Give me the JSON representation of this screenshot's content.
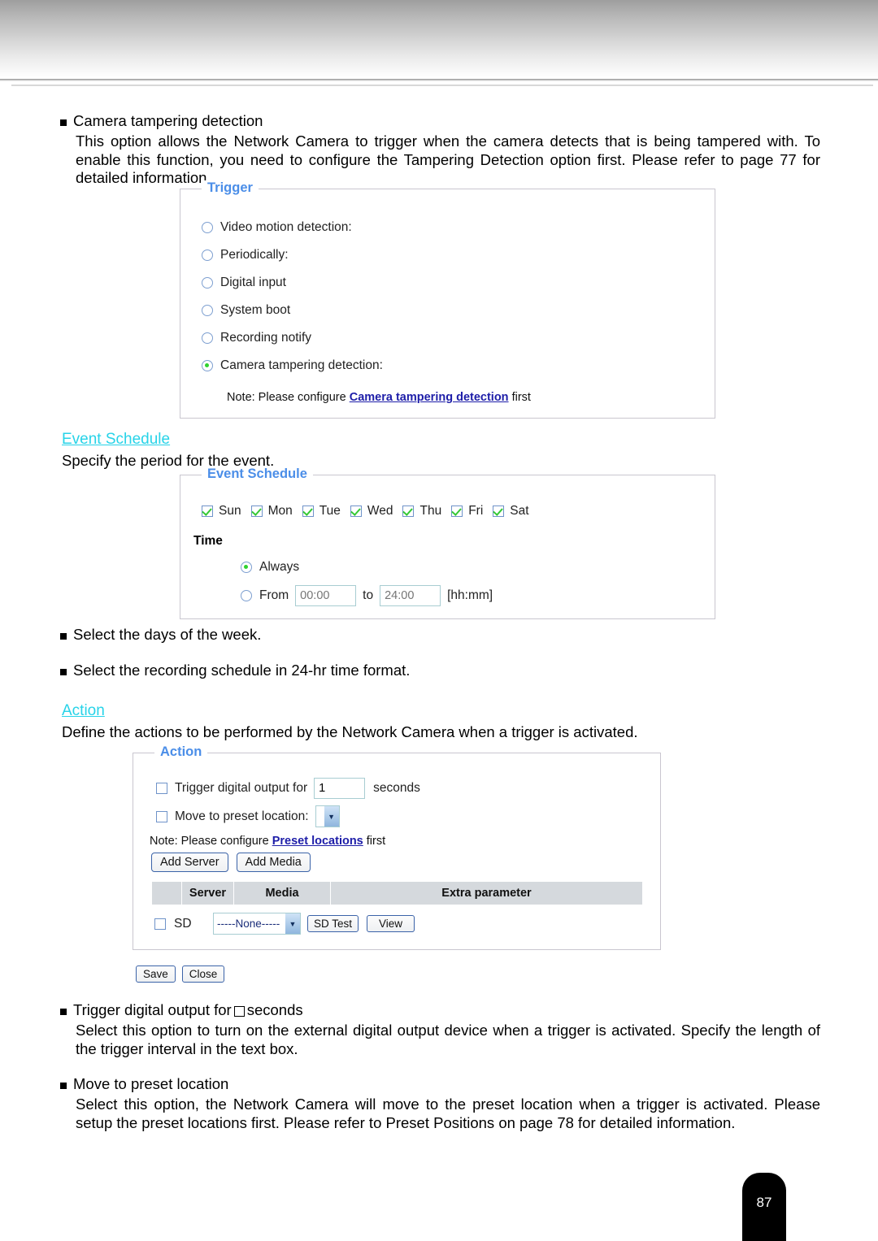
{
  "page": {
    "number": "87"
  },
  "intro": {
    "bullet": "Camera tampering detection",
    "body": "This option allows the Network Camera to trigger when the camera detects that is being tampered with. To enable this function, you need to configure the Tampering Detection option first. Please refer to page 77 for detailed information."
  },
  "trigger_panel": {
    "legend": "Trigger",
    "options": [
      {
        "label": "Video motion detection:",
        "selected": false
      },
      {
        "label": "Periodically:",
        "selected": false
      },
      {
        "label": "Digital input",
        "selected": false
      },
      {
        "label": "System boot",
        "selected": false
      },
      {
        "label": "Recording notify",
        "selected": false
      },
      {
        "label": "Camera tampering detection:",
        "selected": true
      }
    ],
    "note_prefix": "Note: Please configure ",
    "note_link": "Camera tampering detection",
    "note_suffix": " first"
  },
  "event_schedule_section": {
    "heading": "Event Schedule",
    "description": "Specify the period for the event."
  },
  "event_schedule_panel": {
    "legend": "Event Schedule",
    "days": [
      {
        "label": "Sun",
        "checked": true
      },
      {
        "label": "Mon",
        "checked": true
      },
      {
        "label": "Tue",
        "checked": true
      },
      {
        "label": "Wed",
        "checked": true
      },
      {
        "label": "Thu",
        "checked": true
      },
      {
        "label": "Fri",
        "checked": true
      },
      {
        "label": "Sat",
        "checked": true
      }
    ],
    "time_label": "Time",
    "always_label": "Always",
    "always_selected": true,
    "from_label": "From",
    "from_placeholder": "00:00",
    "to_label": "to",
    "to_placeholder": "24:00",
    "format_label": "[hh:mm]"
  },
  "bullets_mid": [
    "Select the days of the week.",
    "Select the recording schedule in 24-hr time format."
  ],
  "action_section": {
    "heading": "Action",
    "description": "Define the actions to be performed by the Network Camera when a trigger is activated."
  },
  "action_panel": {
    "legend": "Action",
    "trigger_do_label": "Trigger digital output for",
    "trigger_do_checked": false,
    "trigger_do_value": "1",
    "seconds_label": "seconds",
    "preset_label": "Move to preset location:",
    "preset_checked": false,
    "preset_value": "",
    "note_prefix": "Note: Please configure ",
    "note_link": "Preset locations",
    "note_suffix": " first",
    "add_server_label": "Add Server",
    "add_media_label": "Add Media",
    "table": {
      "headers": [
        "",
        "Server",
        "Media",
        "Extra parameter"
      ],
      "rows": [
        {
          "checked": false,
          "server": "SD",
          "media": "-----None-----",
          "buttons": [
            "SD Test",
            "View"
          ]
        }
      ]
    }
  },
  "form_buttons": {
    "save": "Save",
    "close": "Close"
  },
  "bottom_bullets": [
    {
      "title_before": "Trigger digital output for",
      "title_after": "seconds",
      "body": "Select this option to turn on the external digital output device when a trigger is activated. Specify the length of the trigger interval in the text box."
    },
    {
      "title": "Move to preset location",
      "body": "Select this option, the Network Camera will move to the preset location when a trigger is activated. Please setup the preset locations first. Please refer to Preset Positions on page 78 for detailed information."
    }
  ]
}
